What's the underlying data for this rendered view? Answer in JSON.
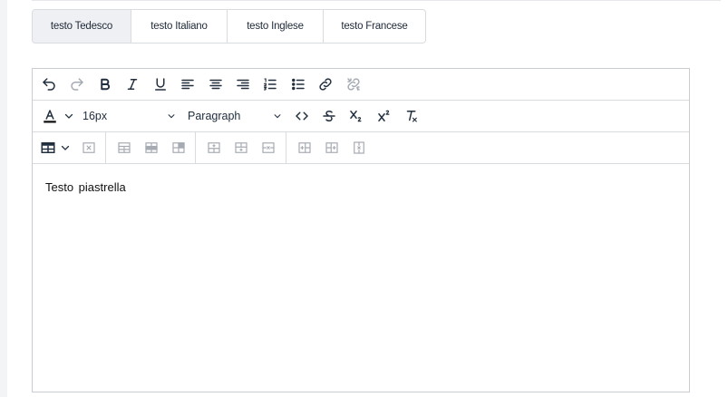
{
  "tabs": [
    {
      "label": "testo Tedesco",
      "active": true
    },
    {
      "label": "testo Italiano",
      "active": false
    },
    {
      "label": "testo Inglese",
      "active": false
    },
    {
      "label": "testo Francese",
      "active": false
    }
  ],
  "toolbar": {
    "row1": [
      "undo-icon",
      "redo-icon",
      "bold-icon",
      "italic-icon",
      "underline-icon",
      "align-left-icon",
      "align-center-icon",
      "align-right-icon",
      "numbered-list-icon",
      "bullet-list-icon",
      "link-icon",
      "unlink-icon"
    ],
    "font_size": "16px",
    "block_format": "Paragraph",
    "row2": [
      "text-color-icon",
      "code-icon",
      "strikethrough-icon",
      "subscript-icon",
      "superscript-icon",
      "clear-formatting-icon"
    ],
    "row3": [
      "table-icon",
      "delete-table-icon",
      "table-row-props-icon",
      "table-cell-props-icon",
      "table-merge-icon",
      "insert-row-before-icon",
      "insert-row-after-icon",
      "delete-row-icon",
      "insert-col-before-icon",
      "insert-col-after-icon",
      "delete-col-icon"
    ],
    "text_color": "#111111"
  },
  "editor": {
    "content": "Testo  piastrella"
  },
  "colors": {
    "active_tab": "#eef0f3",
    "border": "#d8dbe0",
    "icon": "#222f3e",
    "icon_disabled": "#a6abb3"
  }
}
